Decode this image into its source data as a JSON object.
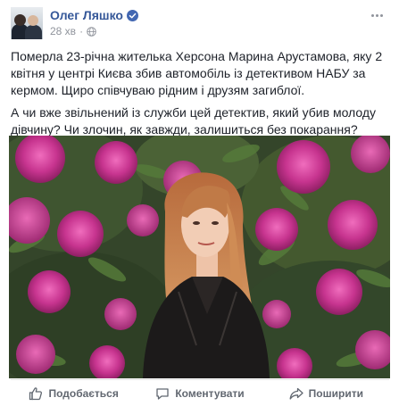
{
  "post": {
    "author": "Олег Ляшко",
    "timestamp": "28 хв",
    "paragraph1": "Померла 23-річна жителька Херсона Марина Арустамова, яку 2 квітня у центрі Києва збив автомобіль із детективом НАБУ за кермом. Щиро співчуваю рідним і друзям загиблої.",
    "paragraph2": "А чи вже звільнений із служби цей детектив, який убив молоду дівчину? Чи злочин, як завжди, залишиться без покарання?",
    "photo_icon": "photo-of-woman-among-rhododendrons",
    "verified_icon": "verified-badge-icon",
    "privacy_icon": "globe-icon"
  },
  "actions": {
    "like_label": "Подобається",
    "comment_label": "Коментувати",
    "share_label": "Поширити"
  },
  "colors": {
    "author": "#365899",
    "verified": "#4267b2",
    "meta": "#90949c",
    "action_text": "#616770",
    "flowers": "#c13a8c"
  }
}
